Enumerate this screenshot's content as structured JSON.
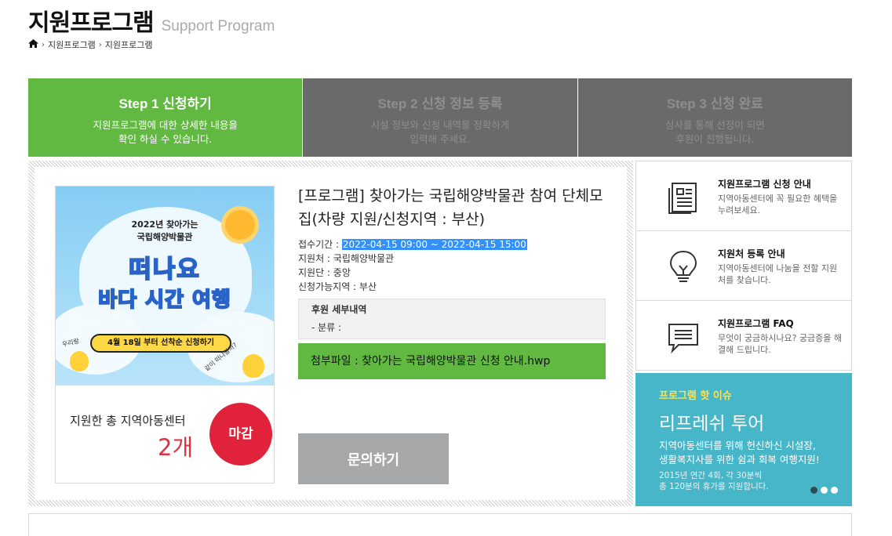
{
  "header": {
    "title": "지원프로그램",
    "subtitle": "Support Program"
  },
  "breadcrumb": {
    "home_icon": "home-icon",
    "items": [
      "지원프로그램",
      "지원프로그램"
    ]
  },
  "steps": [
    {
      "title": "Step 1 신청하기",
      "desc_line1": "지원프로그램에 대한 상세한 내용을",
      "desc_line2": "확인 하실 수 있습니다."
    },
    {
      "title": "Step 2 신청 정보 등록",
      "desc_line1": "시설 정보와 신청 내역을 정확하게",
      "desc_line2": "입력해 주세요."
    },
    {
      "title": "Step 3 신청 완료",
      "desc_line1": "심사를 통해 선정이 되면",
      "desc_line2": "후원이 진행됩니다."
    }
  ],
  "poster": {
    "line1": "2022년 찾아가는",
    "line2": "국립해양박물관",
    "line3": "떠나요",
    "line4": "바다 시간 여행",
    "pill": "4월 18일 부터 선착순 신청하기",
    "sig_left": "우리랑",
    "sig_right": "같이 떠나볼까?"
  },
  "program": {
    "title": "[프로그램] 찾아가는 국립해양박물관 참여 단체모집(차량 지원/신청지역 : 부산)",
    "period_label": "접수기간 : ",
    "period_value": "2022-04-15 09:00 ~ 2022-04-15 15:00",
    "org": "지원처 : 국립해양박물관",
    "group": "지원단 : 중앙",
    "region": "신청가능지역 : 부산",
    "detail_heading": "후원 세부내역",
    "category": "- 분류 :",
    "attachment": "첨부파일 : 찾아가는 국립해양박물관 신청 안내.hwp",
    "support_label": "지원한 총 지역아동센터",
    "support_count": "2개",
    "closed_label": "마감",
    "inquiry_label": "문의하기"
  },
  "sidebar": {
    "items": [
      {
        "icon": "document-icon",
        "title": "지원프로그램 신청 안내",
        "desc": "지역아동센터에 꼭 필요한 혜택을 누려보세요."
      },
      {
        "icon": "lightbulb-icon",
        "title": "지원처 등록 안내",
        "desc": "지역아동센터에 나눔을 전할 지원처를 찾습니다."
      },
      {
        "icon": "chat-icon",
        "title": "지원프로그램 FAQ",
        "desc": "무엇이 궁금하시나요? 궁금증을 해결해 드립니다."
      }
    ]
  },
  "issue": {
    "tag": "프로그램 핫 이슈",
    "title": "리프레쉬 투어",
    "desc_line1": "지역아동센터를 위해 헌신하신 시설장,",
    "desc_line2": "생활복지사를 위한 쉼과 회복 여행지원!",
    "note_line1": "2015년 연간 4회, 각 30분씩",
    "note_line2": "총 120분의 휴가를 지원합니다.",
    "slide_count": 3,
    "active_slide": 1
  },
  "colors": {
    "green": "#61b941",
    "gray_step": "#6a6a6a",
    "red": "#e0223a",
    "teal": "#48b6c9",
    "highlight": "#3390ff"
  }
}
